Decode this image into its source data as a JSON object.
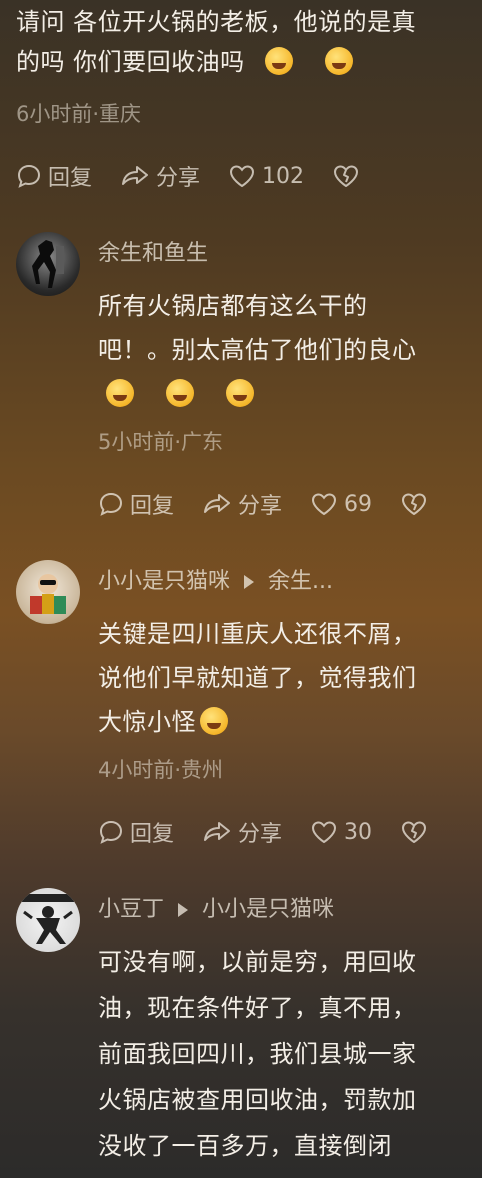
{
  "top_comment": {
    "text_line1": "请问 各位开火锅的老板，他说的是真",
    "text_line2": "的吗 你们要回收油吗",
    "meta": "6小时前·重庆",
    "reply_label": "回复",
    "share_label": "分享",
    "like_count": "102"
  },
  "replies": [
    {
      "username": "余生和鱼生",
      "text_line1": "所有火锅店都有这么干的",
      "text_line2": "吧！。别太高估了他们的良心",
      "meta": "5小时前·广东",
      "reply_label": "回复",
      "share_label": "分享",
      "like_count": "69"
    },
    {
      "username": "小小是只猫咪",
      "reply_to": "余生...",
      "text_line1": "关键是四川重庆人还很不屑，",
      "text_line2": "说他们早就知道了，觉得我们",
      "text_line3": "大惊小怪",
      "meta": "4小时前·贵州",
      "reply_label": "回复",
      "share_label": "分享",
      "like_count": "30"
    },
    {
      "username": "小豆丁",
      "reply_to": "小小是只猫咪",
      "text_line1": "可没有啊，以前是穷，用回收",
      "text_line2": "油，现在条件好了，真不用，",
      "text_line3": "前面我回四川，我们县城一家",
      "text_line4": "火锅店被查用回收油，罚款加",
      "text_line5": "没收了一百多万，直接倒闭"
    }
  ]
}
